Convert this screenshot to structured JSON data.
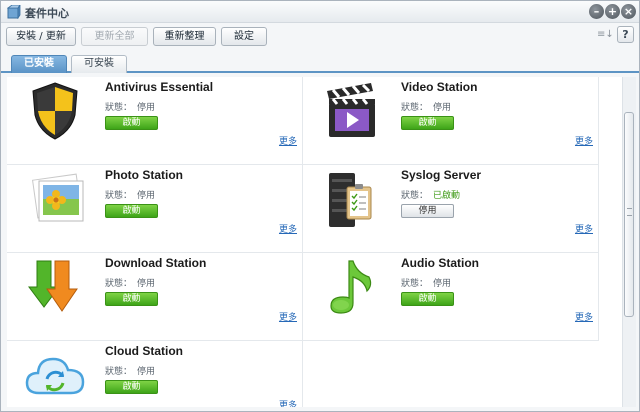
{
  "window": {
    "title": "套件中心",
    "controls": {
      "minimize": "–",
      "maximize": "+",
      "close": "×"
    }
  },
  "toolbar": {
    "install_update": "安裝 / 更新",
    "update_all": "更新全部",
    "reorganize": "重新整理",
    "settings": "設定",
    "sort_icon": "≡↓",
    "help": "?"
  },
  "tabs": [
    {
      "label": "已安裝",
      "active": true
    },
    {
      "label": "可安裝",
      "active": false
    }
  ],
  "packages": [
    {
      "name": "Antivirus Essential",
      "status_label": "狀態：",
      "status": "停用",
      "action": "啟動",
      "more": "更多",
      "icon": "shield-icon"
    },
    {
      "name": "Video Station",
      "status_label": "狀態：",
      "status": "停用",
      "action": "啟動",
      "more": "更多",
      "icon": "clapperboard-icon"
    },
    {
      "name": "Photo Station",
      "status_label": "狀態：",
      "status": "停用",
      "action": "啟動",
      "more": "更多",
      "icon": "photo-icon"
    },
    {
      "name": "Syslog Server",
      "status_label": "狀態：",
      "status": "已啟動",
      "action": "停用",
      "more": "更多",
      "icon": "server-clipboard-icon"
    },
    {
      "name": "Download Station",
      "status_label": "狀態：",
      "status": "停用",
      "action": "啟動",
      "more": "更多",
      "icon": "download-arrows-icon"
    },
    {
      "name": "Audio Station",
      "status_label": "狀態：",
      "status": "停用",
      "action": "啟動",
      "more": "更多",
      "icon": "music-note-icon"
    },
    {
      "name": "Cloud Station",
      "status_label": "狀態：",
      "status": "停用",
      "action": "啟動",
      "more": "更多",
      "icon": "cloud-sync-icon"
    }
  ],
  "colors": {
    "accent": "#5a93c6",
    "run_button": "#4aad1e",
    "link": "#2568b7",
    "running_status": "#3e9a16"
  }
}
